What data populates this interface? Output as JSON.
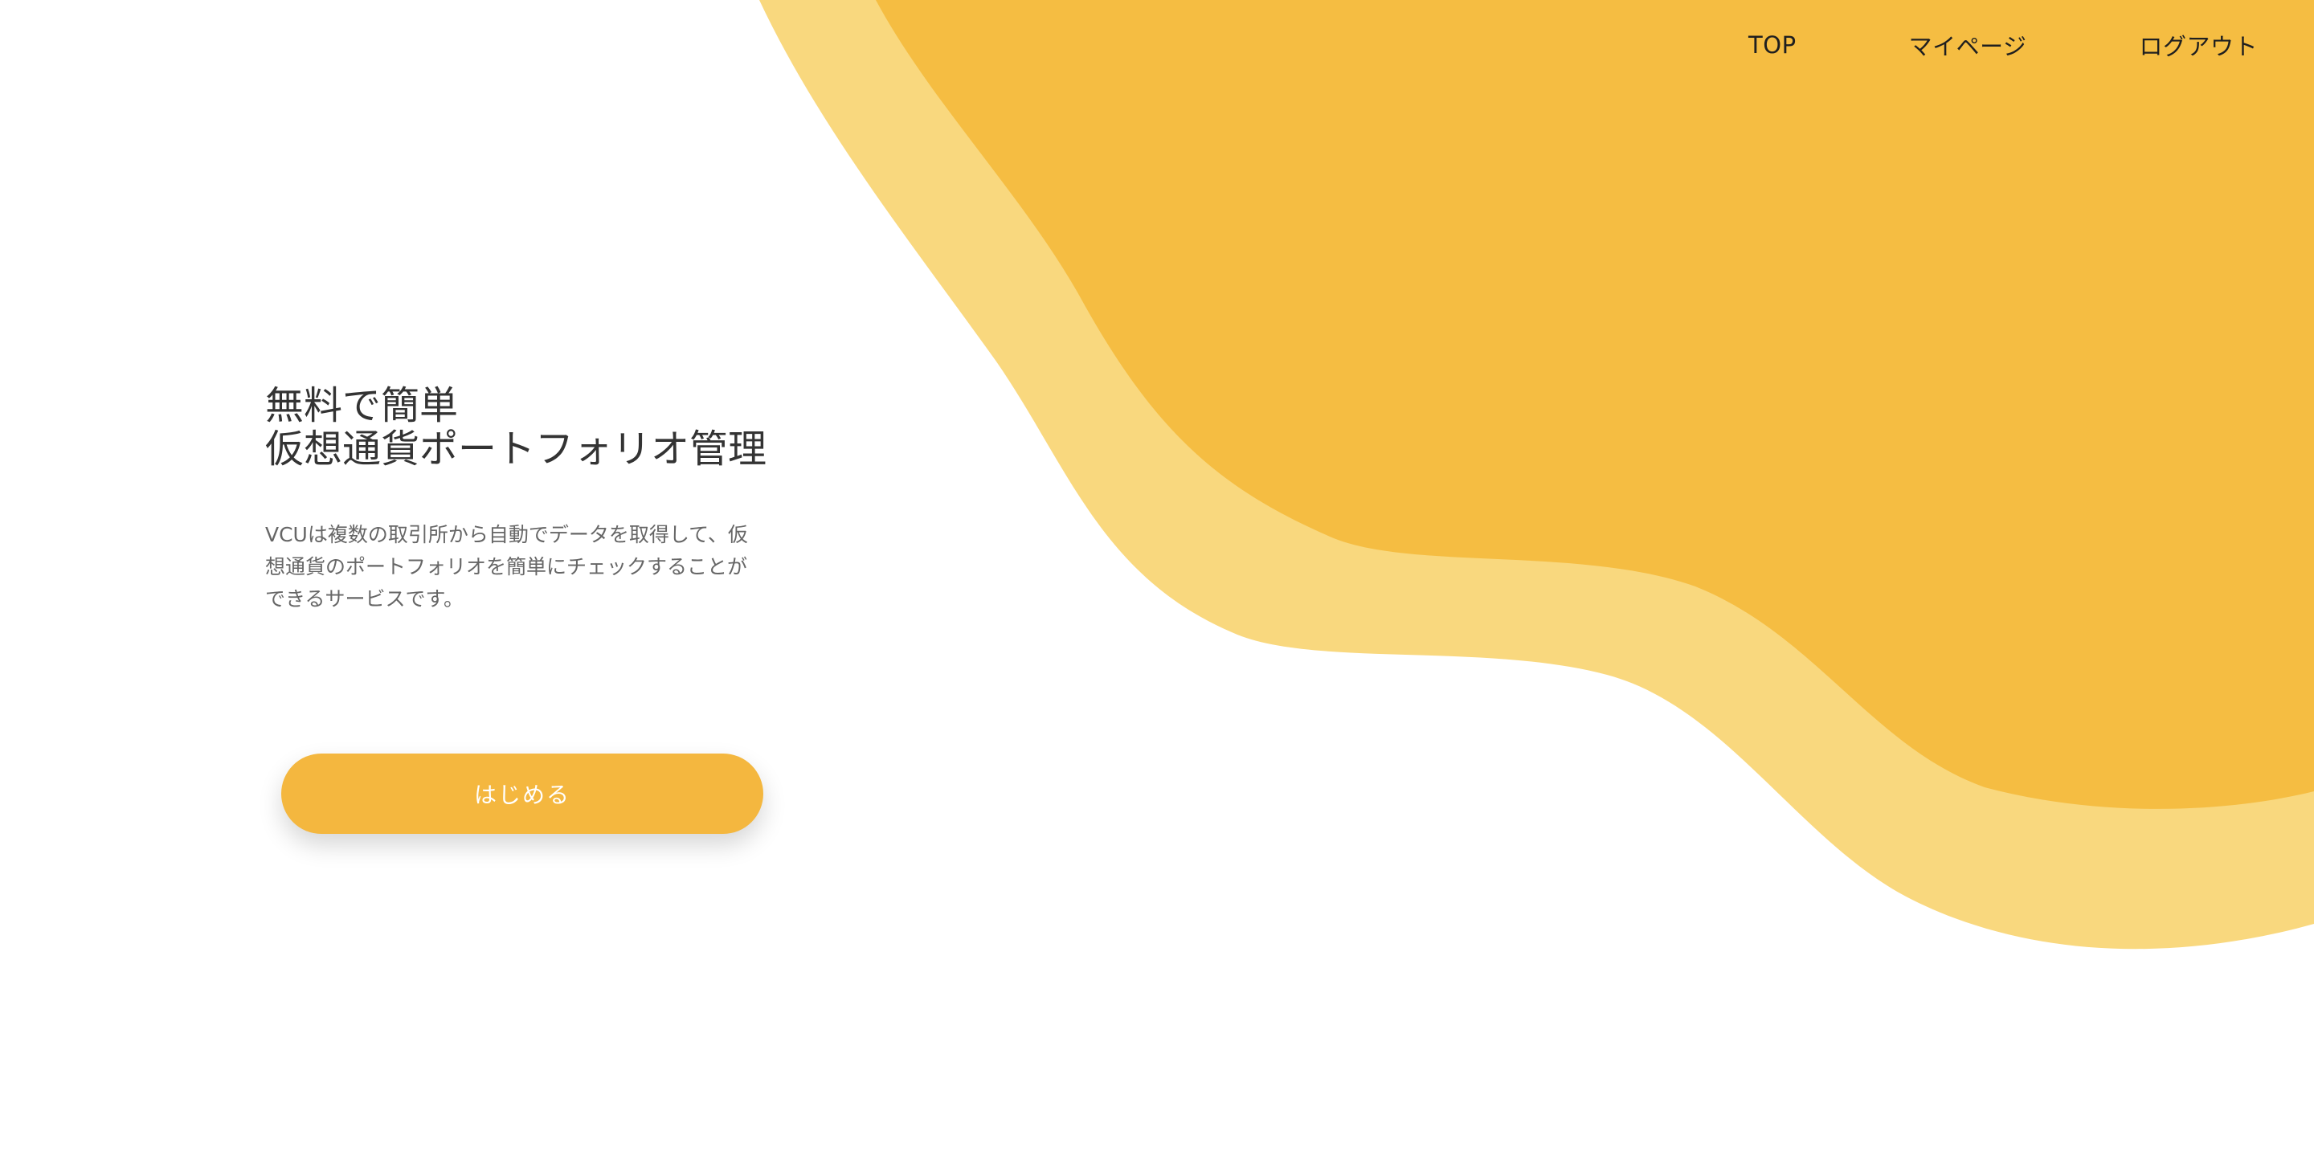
{
  "nav": {
    "items": [
      {
        "label": "TOP"
      },
      {
        "label": "マイページ"
      },
      {
        "label": "ログアウト"
      }
    ]
  },
  "hero": {
    "title_line1": "無料で簡単",
    "title_line2": "仮想通貨ポートフォリオ管理",
    "description": "VCUは複数の取引所から自動でデータを取得して、仮想通貨のポートフォリオを簡単にチェックすることが できるサービスです。",
    "cta_label": "はじめる"
  },
  "colors": {
    "wave_dark": "#f5bd42",
    "wave_light": "#f9d87e",
    "button": "#f4b73f",
    "title_text": "#333333",
    "body_text": "#666666"
  }
}
